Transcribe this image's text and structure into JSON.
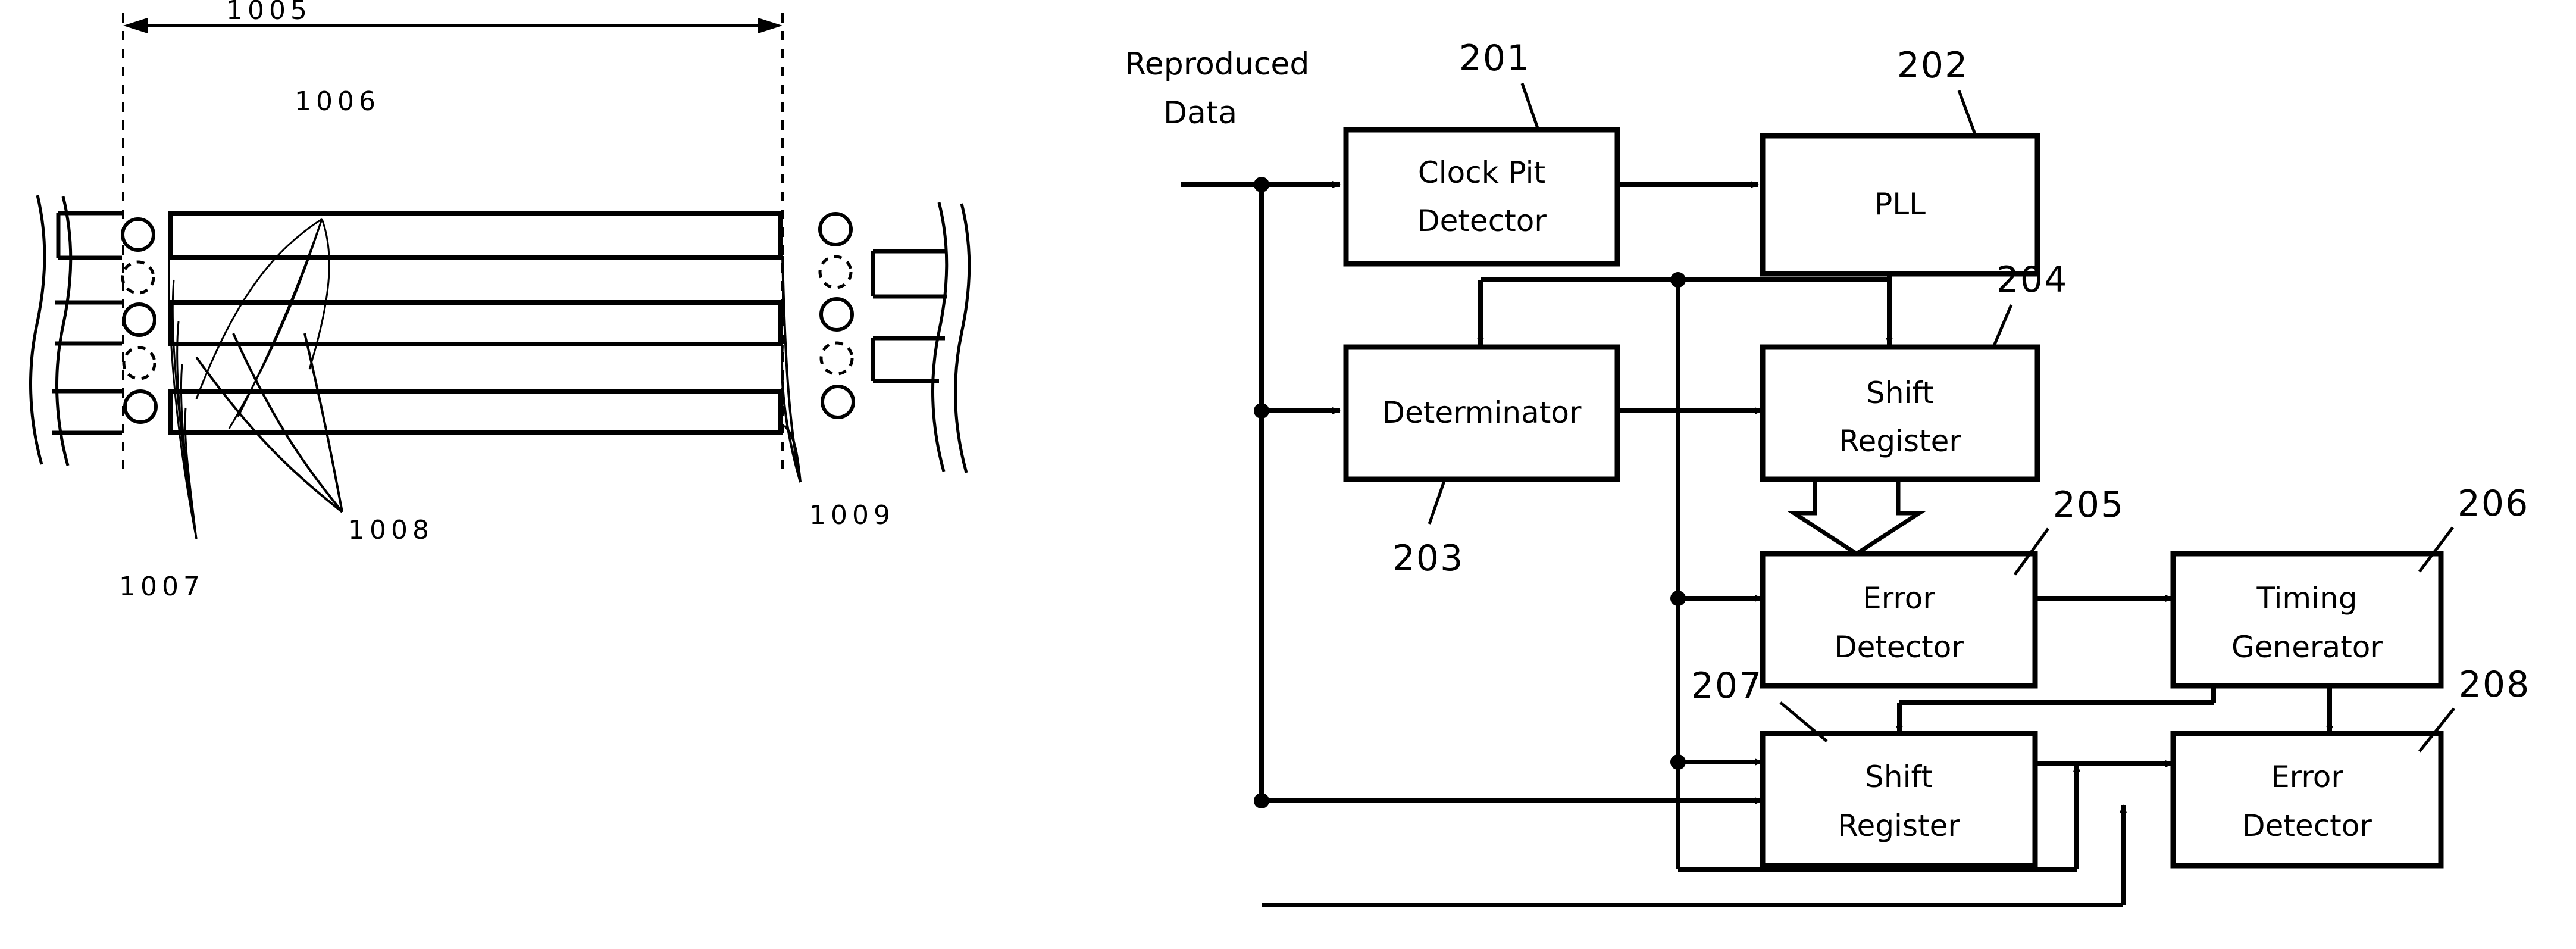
{
  "figure_left": {
    "name": "track-pit-layout-diagram",
    "labels": {
      "dimension_1005": "1005",
      "lead_1006": "1006",
      "lead_1007": "1007",
      "lead_1008": "1008",
      "lead_1009": "1009"
    }
  },
  "figure_right": {
    "name": "signal-processing-block-diagram",
    "input_label_line1": "Reproduced",
    "input_label_line2": "Data",
    "blocks": [
      {
        "id": "201",
        "label_line1": "Clock Pit",
        "label_line2": "Detector",
        "ref": "201"
      },
      {
        "id": "202",
        "label_line1": "PLL",
        "label_line2": "",
        "ref": "202"
      },
      {
        "id": "203",
        "label_line1": "Determinator",
        "label_line2": "",
        "ref": "203"
      },
      {
        "id": "204",
        "label_line1": "Shift",
        "label_line2": "Register",
        "ref": "204"
      },
      {
        "id": "205",
        "label_line1": "Error",
        "label_line2": "Detector",
        "ref": "205"
      },
      {
        "id": "206",
        "label_line1": "Timing",
        "label_line2": "Generator",
        "ref": "206"
      },
      {
        "id": "207",
        "label_line1": "Shift",
        "label_line2": "Register",
        "ref": "207"
      },
      {
        "id": "208",
        "label_line1": "Error",
        "label_line2": "Detector",
        "ref": "208"
      }
    ]
  },
  "colors": {
    "ink": "#000000",
    "paper": "#ffffff"
  }
}
